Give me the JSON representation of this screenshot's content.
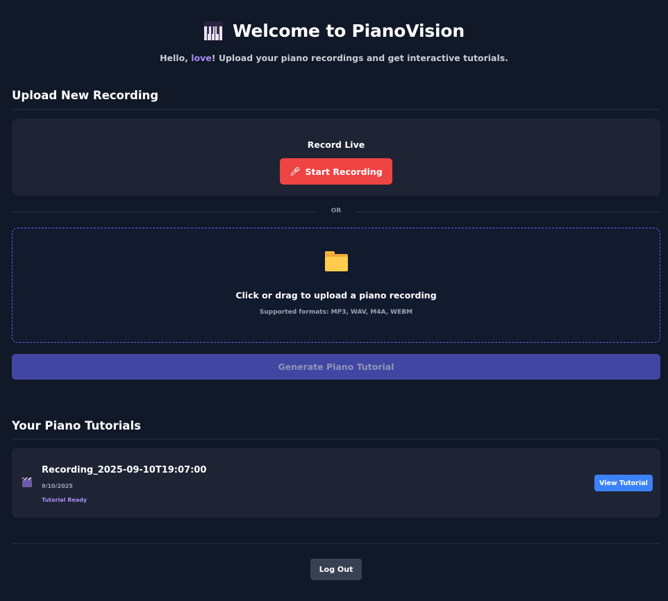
{
  "header": {
    "title": "Welcome to PianoVision",
    "icon": "piano-keys-icon",
    "greeting_prefix": "Hello, ",
    "username": "love",
    "greeting_suffix": "! Upload your piano recordings and get interactive tutorials."
  },
  "upload": {
    "section_title": "Upload New Recording",
    "record_label": "Record Live",
    "record_button": "Start Recording",
    "record_icon": "microphone-icon",
    "divider_text": "OR",
    "dropzone_icon": "folder-icon",
    "dropzone_title": "Click or drag to upload a piano recording",
    "dropzone_formats": "Supported formats: MP3, WAV, M4A, WEBM",
    "generate_button": "Generate Piano Tutorial"
  },
  "tutorials": {
    "section_title": "Your Piano Tutorials",
    "items": [
      {
        "icon": "clapperboard-icon",
        "name": "Recording_2025-09-10T19:07:00",
        "date": "9/10/2025",
        "status": "Tutorial Ready",
        "action": "View Tutorial"
      }
    ]
  },
  "footer": {
    "logout_button": "Log Out"
  },
  "colors": {
    "background": "#111827",
    "card": "#1e2433",
    "accent_purple": "#a78bfa",
    "record_red": "#ef4444",
    "generate_indigo": "#4146a2",
    "view_blue": "#3b82f6",
    "logout_gray": "#374151"
  }
}
